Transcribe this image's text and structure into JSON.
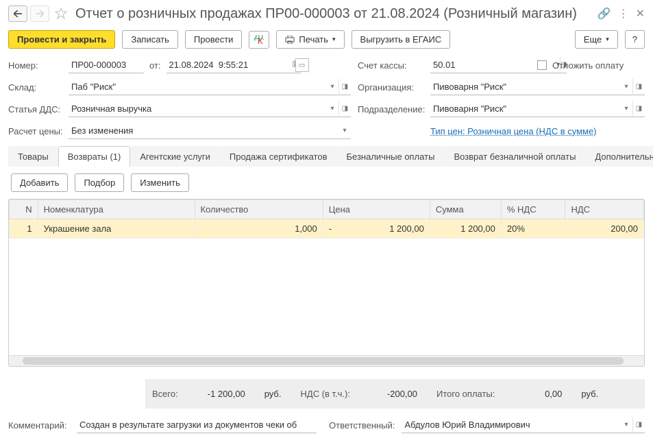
{
  "title": "Отчет о розничных продажах ПР00-000003 от 21.08.2024 (Розничный магазин)",
  "toolbar": {
    "submit_close": "Провести и закрыть",
    "save": "Записать",
    "submit": "Провести",
    "print": "Печать",
    "egais": "Выгрузить в ЕГАИС",
    "more": "Еще",
    "help": "?"
  },
  "fields": {
    "number_label": "Номер:",
    "number": "ПР00-000003",
    "from_label": "от:",
    "date": "21.08.2024  9:55:21",
    "cash_label": "Счет кассы:",
    "cash": "50.01",
    "postpone": "Отложить оплату",
    "warehouse_label": "Склад:",
    "warehouse": "Паб \"Риск\"",
    "org_label": "Организация:",
    "org": "Пивоварня \"Риск\"",
    "dds_label": "Статья ДДС:",
    "dds": "Розничная выручка",
    "division_label": "Подразделение:",
    "division": "Пивоварня \"Риск\"",
    "price_calc_label": "Расчет цены:",
    "price_calc": "Без изменения",
    "price_type_link": "Тип цен: Розничная цена (НДС в сумме)"
  },
  "tabs": [
    "Товары",
    "Возвраты (1)",
    "Агентские услуги",
    "Продажа сертификатов",
    "Безналичные оплаты",
    "Возврат безналичной оплаты",
    "Дополнительно"
  ],
  "subtoolbar": {
    "add": "Добавить",
    "select": "Подбор",
    "edit": "Изменить"
  },
  "grid": {
    "headers": {
      "n": "N",
      "nom": "Номенклатура",
      "qty": "Количество",
      "price": "Цена",
      "sum": "Сумма",
      "vatp": "% НДС",
      "vat": "НДС"
    },
    "rows": [
      {
        "n": "1",
        "nom": "Украшение зала",
        "qty": "1,000",
        "price_prefix": "-",
        "price": "1 200,00",
        "sum": "1 200,00",
        "vatp": "20%",
        "vat": "200,00"
      }
    ]
  },
  "totals": {
    "total_label": "Всего:",
    "total": "-1 200,00",
    "cur": "руб.",
    "vat_label": "НДС (в т.ч.):",
    "vat": "-200,00",
    "paid_label": "Итого оплаты:",
    "paid": "0,00"
  },
  "footer": {
    "comment_label": "Комментарий:",
    "comment": "Создан в результате загрузки из документов чеки об",
    "responsible_label": "Ответственный:",
    "responsible": "Абдулов Юрий Владимирович"
  }
}
